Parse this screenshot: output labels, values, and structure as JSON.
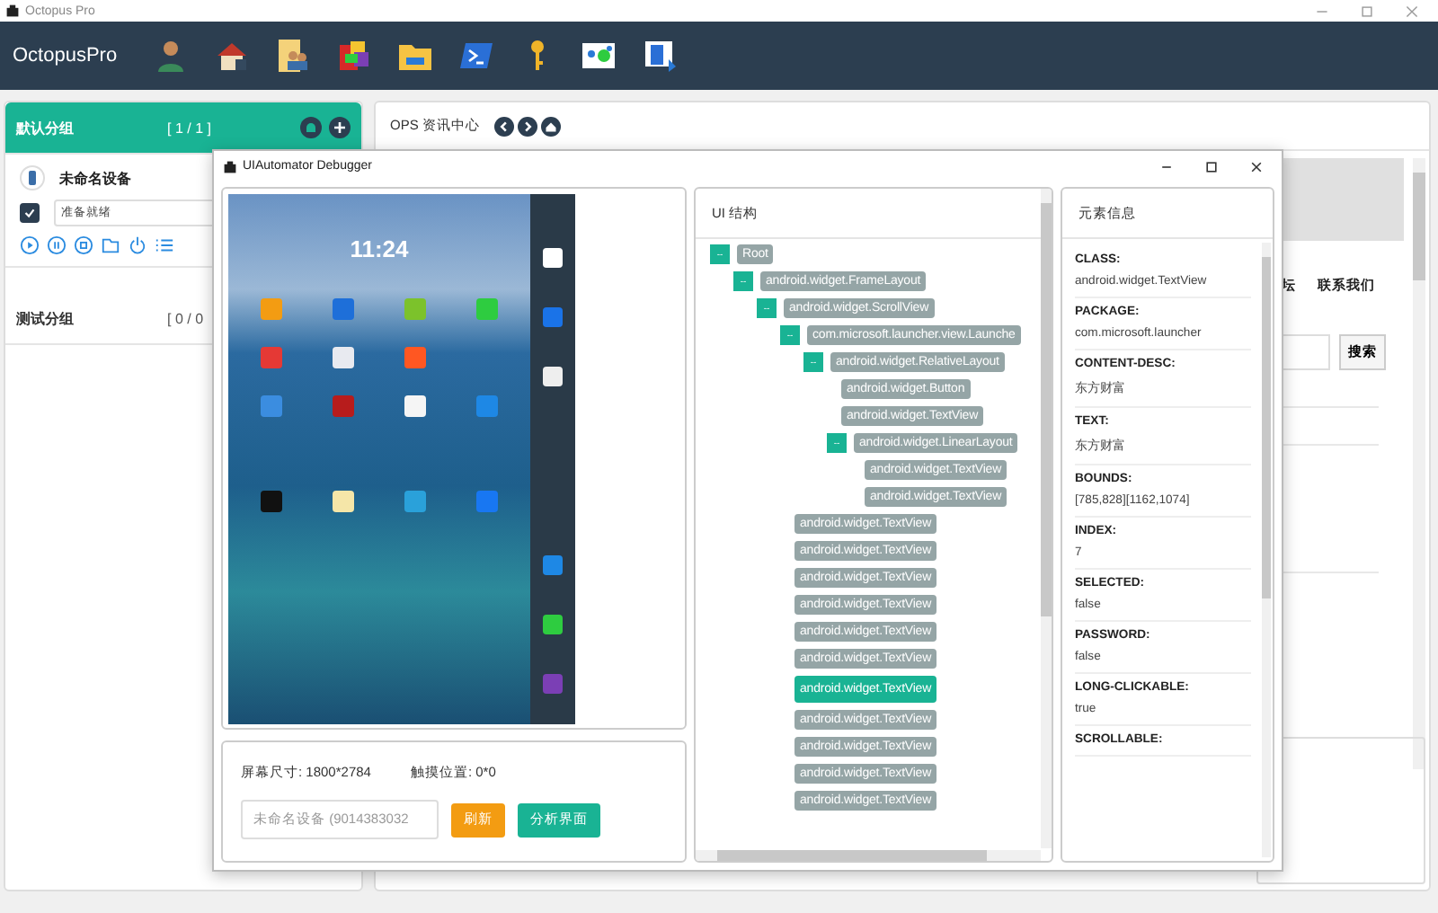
{
  "window": {
    "title": "Octopus Pro"
  },
  "header": {
    "brand": "OctopusPro"
  },
  "groups": [
    {
      "name": "默认分组",
      "count": "[ 1 / 1 ]",
      "selected": true,
      "devices": [
        {
          "name": "未命名设备",
          "checked": true,
          "status": "准备就绪"
        }
      ]
    },
    {
      "name": "测试分组",
      "count": "[ 0 / 0",
      "selected": false
    }
  ],
  "news": {
    "title": "OPS 资讯中心",
    "links": [
      "坛",
      "联系我们"
    ],
    "search_button": "搜索"
  },
  "debugger": {
    "title": "UIAutomator Debugger",
    "clock": "11:24",
    "screen_size": "屏幕尺寸: 1800*2784",
    "touch_pos": "触摸位置: 0*0",
    "device_select": "未命名设备 (9014383032",
    "refresh": "刷新",
    "analyze": "分析界面",
    "tree_title": "UI 结构",
    "tree": [
      {
        "label": "Root",
        "toggle": "--",
        "expanded": true,
        "selected": false,
        "children": [
          {
            "label": "android.widget.FrameLayout",
            "toggle": "--",
            "expanded": true,
            "selected": false,
            "children": [
              {
                "label": "android.widget.ScrollView",
                "toggle": "--",
                "expanded": true,
                "selected": false,
                "children": [
                  {
                    "label": "com.microsoft.launcher.view.Launche",
                    "toggle": "--",
                    "expanded": true,
                    "selected": false,
                    "children": [
                      {
                        "label": "android.widget.RelativeLayout",
                        "toggle": "--",
                        "expanded": true,
                        "selected": false,
                        "children": [
                          {
                            "label": "android.widget.Button",
                            "selected": false
                          },
                          {
                            "label": "android.widget.TextView",
                            "selected": false
                          },
                          {
                            "label": "android.widget.LinearLayout",
                            "toggle": "--",
                            "expanded": true,
                            "selected": false,
                            "children": [
                              {
                                "label": "android.widget.TextView",
                                "selected": false
                              },
                              {
                                "label": "android.widget.TextView",
                                "selected": false
                              }
                            ]
                          }
                        ]
                      }
                    ]
                  },
                  {
                    "label": "android.widget.TextView",
                    "selected": false
                  },
                  {
                    "label": "android.widget.TextView",
                    "selected": false
                  },
                  {
                    "label": "android.widget.TextView",
                    "selected": false
                  },
                  {
                    "label": "android.widget.TextView",
                    "selected": false
                  },
                  {
                    "label": "android.widget.TextView",
                    "selected": false
                  },
                  {
                    "label": "android.widget.TextView",
                    "selected": false
                  },
                  {
                    "label": "android.widget.TextView",
                    "selected": true
                  },
                  {
                    "label": "android.widget.TextView",
                    "selected": false
                  },
                  {
                    "label": "android.widget.TextView",
                    "selected": false
                  },
                  {
                    "label": "android.widget.TextView",
                    "selected": false
                  },
                  {
                    "label": "android.widget.TextView",
                    "selected": false
                  }
                ]
              }
            ]
          }
        ]
      }
    ],
    "info_title": "元素信息",
    "info": [
      {
        "label": "CLASS:",
        "value": "android.widget.TextView"
      },
      {
        "label": "PACKAGE:",
        "value": "com.microsoft.launcher"
      },
      {
        "label": "CONTENT-DESC:",
        "value": "东方财富"
      },
      {
        "label": "TEXT:",
        "value": "东方财富"
      },
      {
        "label": "BOUNDS:",
        "value": "[785,828][1162,1074]"
      },
      {
        "label": "INDEX:",
        "value": "7"
      },
      {
        "label": "SELECTED:",
        "value": "false"
      },
      {
        "label": "PASSWORD:",
        "value": "false"
      },
      {
        "label": "LONG-CLICKABLE:",
        "value": "true"
      },
      {
        "label": "SCROLLABLE:"
      }
    ]
  }
}
